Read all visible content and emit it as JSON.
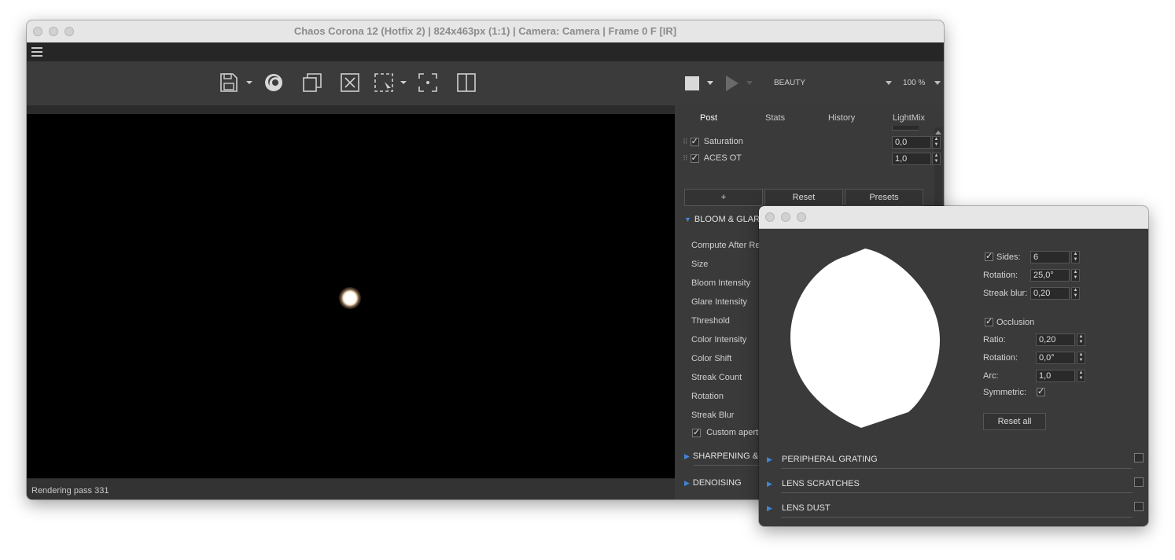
{
  "main": {
    "title": "Chaos Corona 12 (Hotfix 2) | 824x463px (1:1) | Camera: Camera | Frame 0 F [IR]",
    "status": "Rendering pass 331",
    "pass_selector": "BEAUTY",
    "zoom": "100 %",
    "tabs": [
      "Post",
      "Stats",
      "History",
      "LightMix"
    ],
    "post_rows": [
      {
        "label": "Saturation",
        "value": "0,0"
      },
      {
        "label": "ACES OT",
        "value": "1,0"
      }
    ],
    "buttons": {
      "add": "+",
      "reset": "Reset",
      "presets": "Presets"
    },
    "bloom_section": "BLOOM & GLARE",
    "bloom_params": [
      "Compute After Re",
      "Size",
      "Bloom Intensity",
      "Glare Intensity",
      "Threshold",
      "Color Intensity",
      "Color Shift",
      "Streak Count",
      "Rotation",
      "Streak Blur"
    ],
    "custom_aperture": "Custom apertu",
    "sharpening_section": "SHARPENING & B",
    "denoising_section": "DENOISING"
  },
  "aperture": {
    "sides_label": "Sides:",
    "sides_value": "6",
    "rotation_label": "Rotation:",
    "rotation_value": "25,0°",
    "streak_label": "Streak blur:",
    "streak_value": "0,20",
    "occlusion_label": "Occlusion",
    "ratio_label": "Ratio:",
    "ratio_value": "0,20",
    "rotation2_label": "Rotation:",
    "rotation2_value": "0,0°",
    "arc_label": "Arc:",
    "arc_value": "1,0",
    "symmetric_label": "Symmetric:",
    "reset_all": "Reset all",
    "sections": [
      "PERIPHERAL GRATING",
      "LENS SCRATCHES",
      "LENS DUST"
    ]
  },
  "colors": {
    "accent": "#3f86d8",
    "panel": "#3a3a3a",
    "render_bg": "#000000"
  },
  "icons": [
    "save-icon",
    "corona-logo-icon",
    "copy-icon",
    "clear-icon",
    "region-select-icon",
    "focus-pick-icon",
    "compare-icon",
    "stop-icon",
    "play-icon"
  ]
}
